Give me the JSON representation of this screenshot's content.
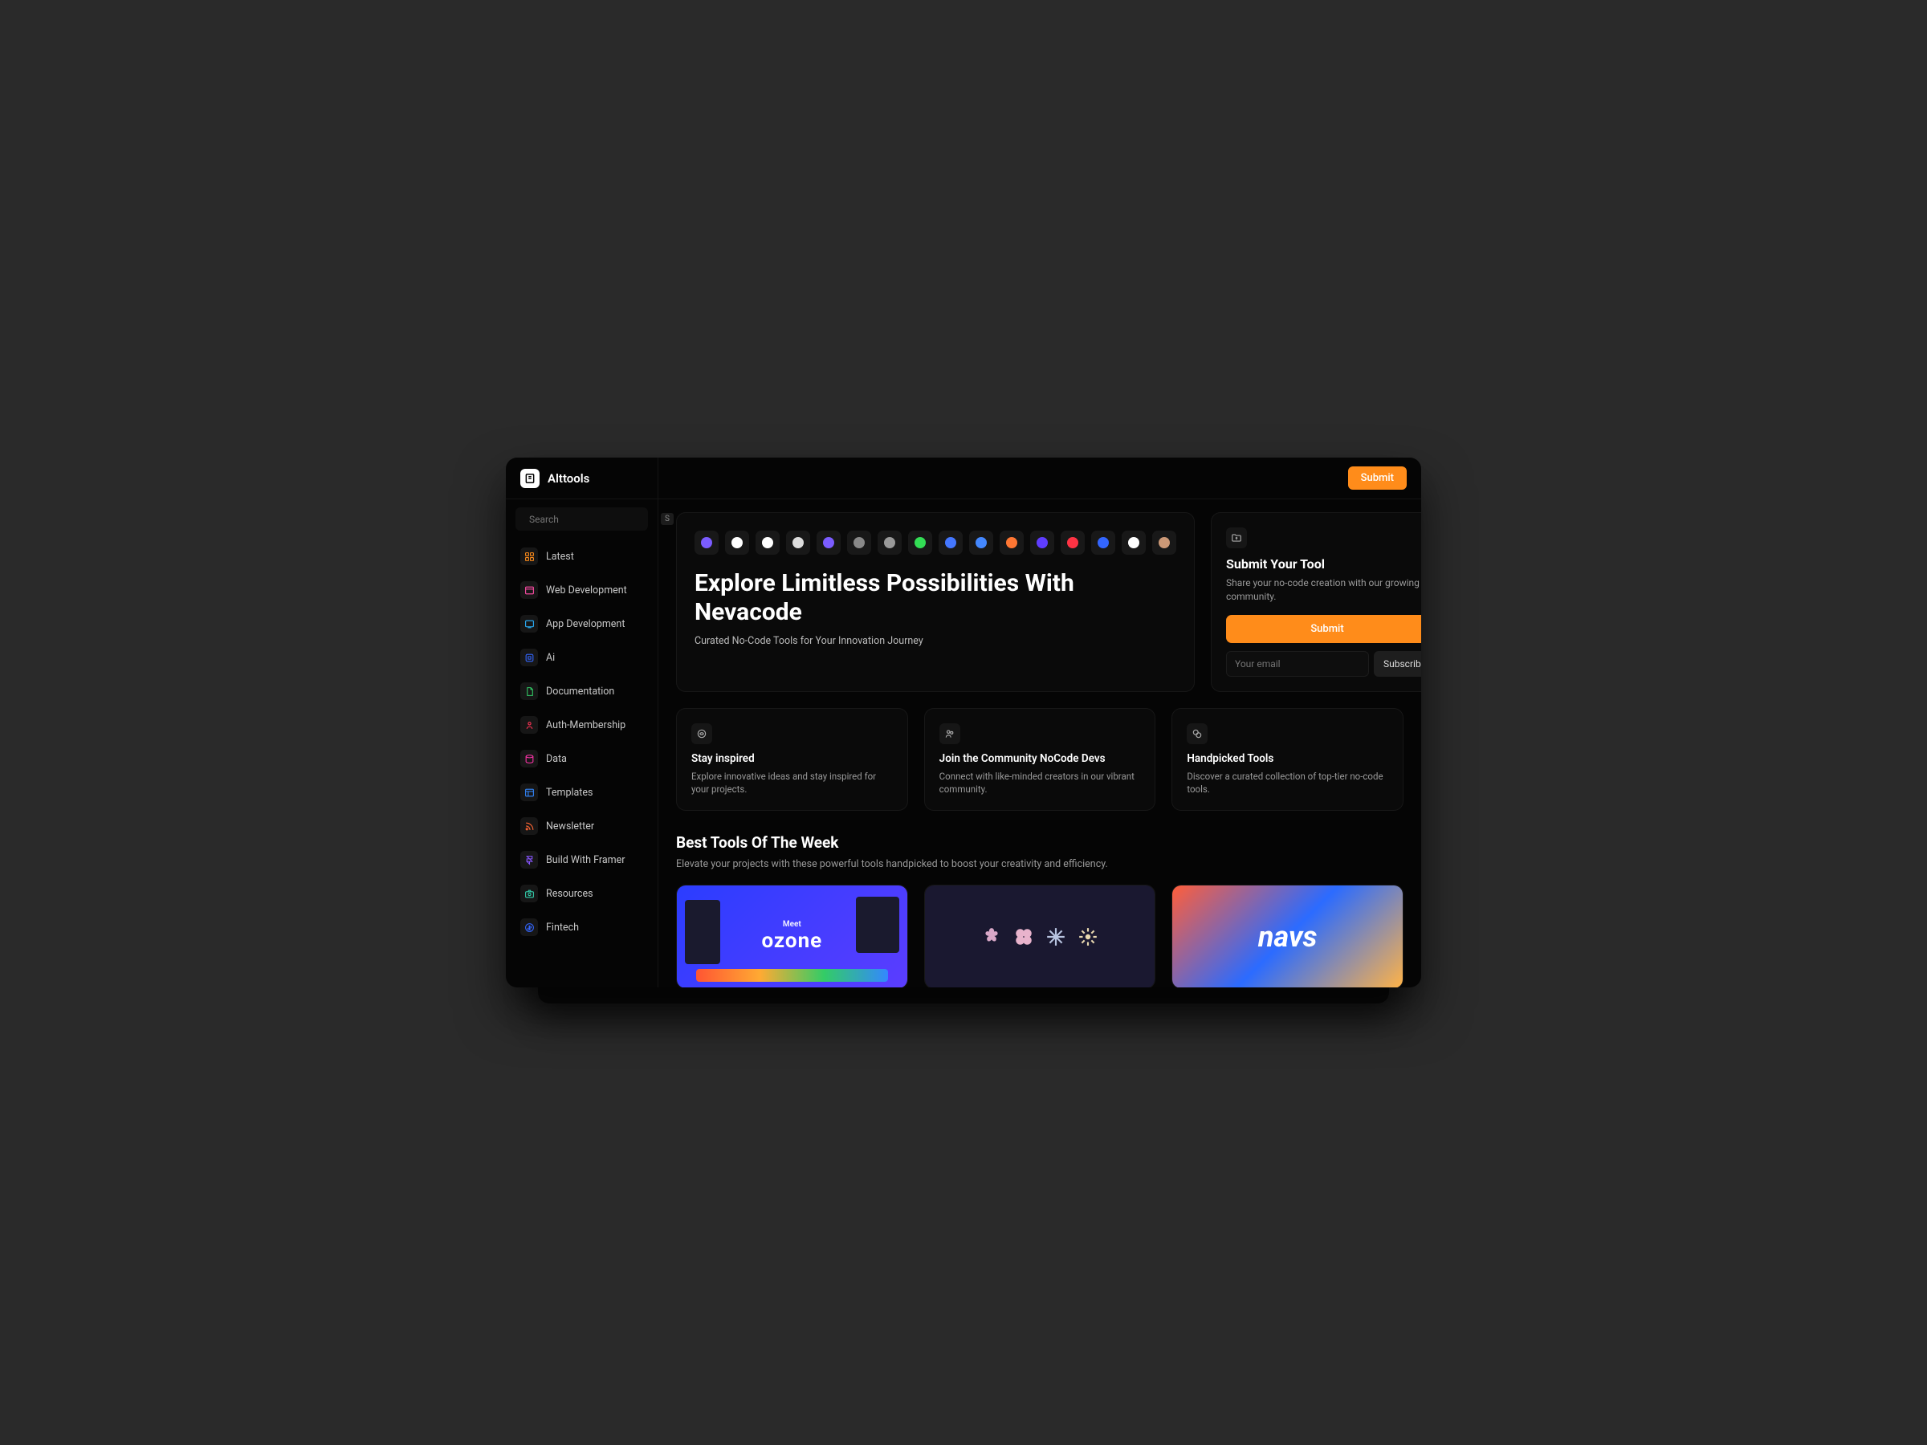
{
  "brand": "Alttools",
  "header": {
    "submit": "Submit"
  },
  "search": {
    "placeholder": "Search",
    "shortcut": "S"
  },
  "nav": [
    {
      "label": "Latest",
      "icon": "grid-icon",
      "color": "#ff8c1a"
    },
    {
      "label": "Web Development",
      "icon": "window-icon",
      "color": "#ff4da6"
    },
    {
      "label": "App Development",
      "icon": "app-icon",
      "color": "#2bb3ff"
    },
    {
      "label": "Ai",
      "icon": "ai-icon",
      "color": "#3366ff"
    },
    {
      "label": "Documentation",
      "icon": "doc-icon",
      "color": "#33cc66"
    },
    {
      "label": "Auth-Membership",
      "icon": "auth-icon",
      "color": "#ff3355"
    },
    {
      "label": "Data",
      "icon": "data-icon",
      "color": "#ff33aa"
    },
    {
      "label": "Templates",
      "icon": "template-icon",
      "color": "#3388ff"
    },
    {
      "label": "Newsletter",
      "icon": "rss-icon",
      "color": "#ff6633"
    },
    {
      "label": "Build With Framer",
      "icon": "framer-icon",
      "color": "#8855ff"
    },
    {
      "label": "Resources",
      "icon": "camera-icon",
      "color": "#33ccaa"
    },
    {
      "label": "Fintech",
      "icon": "fintech-icon",
      "color": "#3366ff"
    }
  ],
  "hero": {
    "title": "Explore Limitless Possibilities With Nevacode",
    "subtitle": "Curated No-Code Tools for Your Innovation Journey",
    "icons": [
      "#7b5cff",
      "#ffffff",
      "#ffffff",
      "#dddddd",
      "#7b5cff",
      "#888888",
      "#999999",
      "#33dd55",
      "#4477ff",
      "#4488ff",
      "#ff7733",
      "#5f3dff",
      "#ff3344",
      "#3366ff",
      "#ffffff",
      "#cc9977"
    ]
  },
  "submit_card": {
    "title": "Submit Your Tool",
    "desc": "Share your no-code creation with our growing community.",
    "button": "Submit",
    "email_placeholder": "Your email",
    "subscribe": "Subscribe"
  },
  "info": [
    {
      "title": "Stay inspired",
      "desc": "Explore innovative ideas and stay inspired for your projects."
    },
    {
      "title": "Join the Community NoCode Devs",
      "desc": "Connect with like-minded creators in our vibrant community."
    },
    {
      "title": "Handpicked Tools",
      "desc": "Discover a curated collection of top-tier no-code tools."
    }
  ],
  "week": {
    "title": "Best Tools Of The Week",
    "subtitle": "Elevate your projects with these powerful tools handpicked to boost your creativity and efficiency.",
    "tools": [
      {
        "name": "ozone",
        "tagline": "Meet"
      },
      {
        "name": "shapes"
      },
      {
        "name": "navs"
      }
    ]
  }
}
